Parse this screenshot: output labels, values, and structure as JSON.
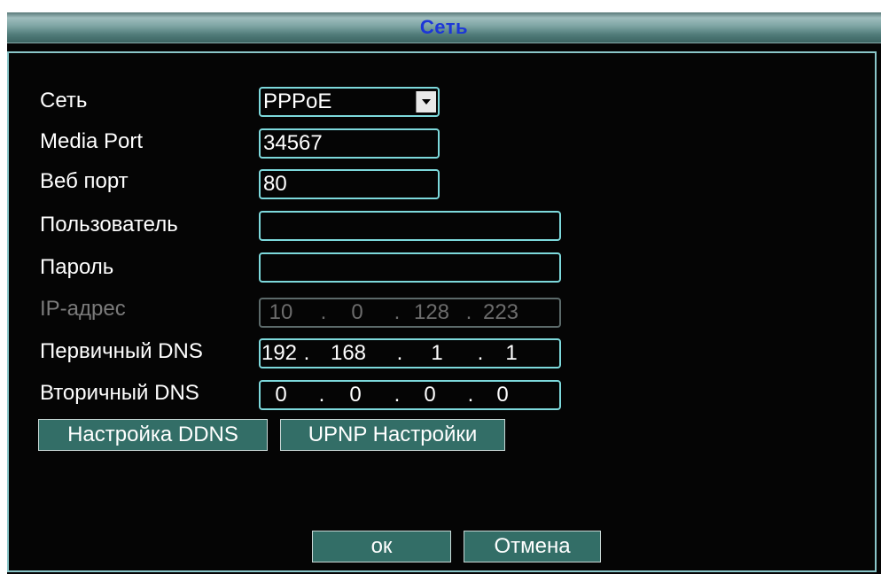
{
  "window": {
    "title": "Сеть"
  },
  "form": {
    "network": {
      "label": "Сеть",
      "value": "PPPoE"
    },
    "media_port": {
      "label": "Media Port",
      "value": "34567"
    },
    "web_port": {
      "label": "Веб порт",
      "value": "80"
    },
    "user": {
      "label": "Пользователь",
      "value": ""
    },
    "password": {
      "label": "Пароль",
      "value": ""
    },
    "ip_address": {
      "label": "IP-адрес",
      "parts": [
        "10",
        "0",
        "128",
        "223"
      ]
    },
    "primary_dns": {
      "label": "Первичный DNS",
      "parts": [
        "192",
        "168",
        "1",
        "1"
      ]
    },
    "secondary_dns": {
      "label": "Вторичный DNS",
      "parts": [
        "0",
        "0",
        "0",
        "0"
      ]
    },
    "ip_separator": "."
  },
  "buttons": {
    "ddns": "Настройка DDNS",
    "upnp": "UPNP Настройки",
    "ok": "ок",
    "cancel": "Отмена"
  },
  "colors": {
    "title_text": "#1d37d8",
    "field_border": "#7dd9dc",
    "button_bg": "#336e67",
    "background": "#050505"
  }
}
